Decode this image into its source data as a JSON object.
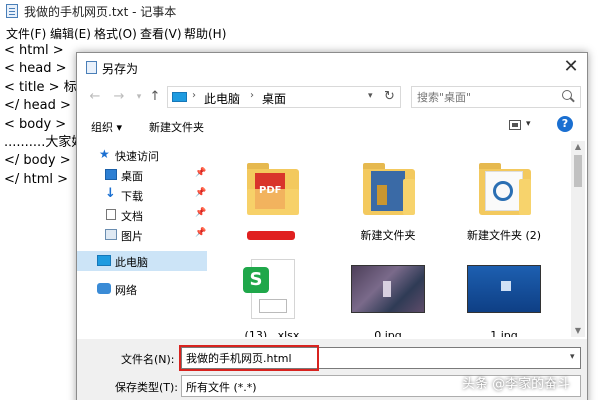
{
  "notepad": {
    "title": "我做的手机网页.txt - 记事本",
    "menu": [
      "文件(F)",
      "编辑(E)",
      "格式(O)",
      "查看(V)",
      "帮助(H)"
    ],
    "lines": [
      "< html >",
      "< head >",
      "< title > 标题",
      "</ head >",
      "< body >",
      "..........大家好",
      "</ body >",
      "</ html >"
    ]
  },
  "dialog": {
    "title": "另存为",
    "close": "✕",
    "address": {
      "crumbs": [
        "此电脑",
        "桌面"
      ],
      "separator": "›"
    },
    "search": {
      "placeholder": "搜索\"桌面\""
    },
    "toolbar": {
      "organize": "组织 ▾",
      "new_folder": "新建文件夹",
      "help": "?"
    },
    "nav": [
      {
        "label": "快速访问",
        "icon": "star-icon"
      },
      {
        "label": "桌面",
        "icon": "desktop-icon",
        "pinned": true
      },
      {
        "label": "下载",
        "icon": "download-icon",
        "pinned": true
      },
      {
        "label": "文档",
        "icon": "document-icon",
        "pinned": true
      },
      {
        "label": "图片",
        "icon": "picture-icon",
        "pinned": true
      },
      {
        "label": "此电脑",
        "icon": "computer-icon",
        "selected": true
      },
      {
        "label": "网络",
        "icon": "network-icon"
      }
    ],
    "files": [
      {
        "name": "",
        "type": "folder-pdf",
        "icon": "pdf-folder-icon"
      },
      {
        "name": "新建文件夹",
        "type": "folder",
        "icon": "folder-icon"
      },
      {
        "name": "新建文件夹 (2)",
        "type": "folder",
        "icon": "folder-icon"
      },
      {
        "name": "(13)...xlsx",
        "type": "xlsx",
        "icon": "spreadsheet-icon"
      },
      {
        "name": "0.jpg",
        "type": "image",
        "icon": "image-thumbnail"
      },
      {
        "name": "1.jpg",
        "type": "image",
        "icon": "image-thumbnail"
      }
    ],
    "form": {
      "filename_label": "文件名(N):",
      "filename_value": "我做的手机网页.html",
      "filetype_label": "保存类型(T):",
      "filetype_value": "所有文件 (*.*)"
    }
  },
  "watermark": "头条 @李家的奋斗",
  "colors": {
    "accent": "#1a6fd1",
    "selection": "#cce4f7",
    "highlight": "#d8231f",
    "folder": "#f3c95e"
  }
}
